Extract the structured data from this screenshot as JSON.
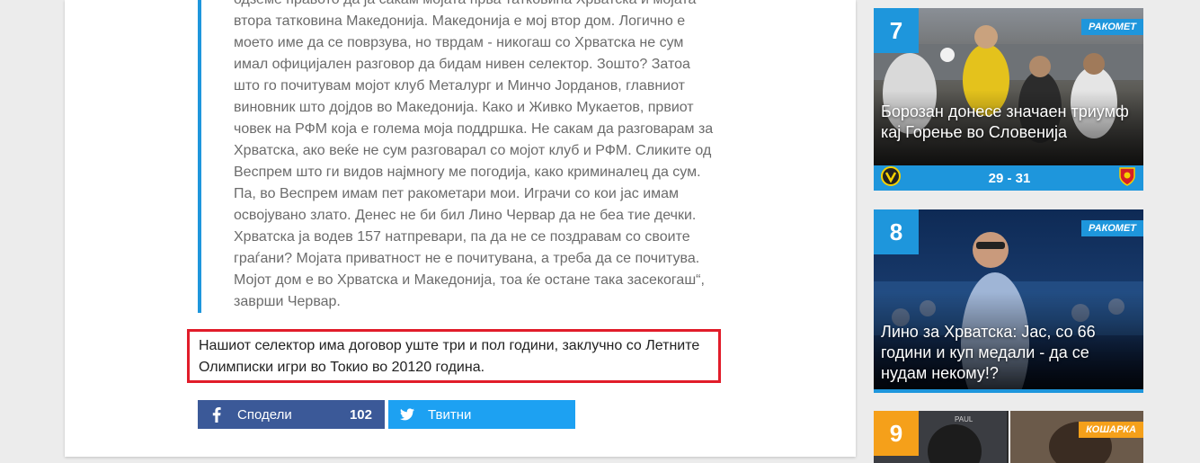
{
  "article": {
    "quote_lines": [
      "одземе правото да ја сакам мојата прва татковина Хрватска и мојата",
      "втора татковина Македонија. Македонија е мој втор дом. Логично е",
      "моето име да се поврзува, но тврдам - никогаш со Хрватска не сум",
      "имал официјален разговор да бидам нивен селектор. Зошто? Затоа",
      "што го почитувам мојот клуб Металург и Минчо Јорданов, главниот",
      "виновник што дојдов во Македонија. Како и Живко Мукаетов, првиот",
      "човек на РФМ која е голема моја поддршка. Не сакам да разговарам за",
      "Хрватска, ако веќе не сум разговарал со мојот клуб и РФМ. Сликите од",
      "Веспрем што ги видов најмногу ме погодија, како криминалец да сум.",
      "Па, во Веспрем имам пет ракометари мои. Играчи со кои јас имам",
      "освојувано злато. Денес не би бил Лино Червар да не беа тие дечки.",
      "Хрватска ја водев 157 натпревари, па да не се поздравам со своите",
      "граѓани? Мојата приватност не е почитувана, а треба да се почитува.",
      "Мојот дом е во Хрватска и Македонија, тоа ќе остане така засекогаш“,",
      "заврши Червар."
    ],
    "highlight_lines": [
      "Нашиот селектор има договор уште три и пол години, заклучно со Летните",
      "Олимписки игри во Токио во 20120 година."
    ]
  },
  "share": {
    "facebook_label": "Сподели",
    "facebook_count": "102",
    "twitter_label": "Твитни",
    "facebook_icon": "f",
    "twitter_icon": "bird"
  },
  "sidebar": {
    "cards": [
      {
        "number": "7",
        "category": "РАКОМЕТ",
        "title": "Борозан донесе значаен триумф кај Горење во Словенија",
        "score": "29 - 31"
      },
      {
        "number": "8",
        "category": "РАКОМЕТ",
        "title": "Лино за Хрватска: Јас, со 66 години и куп медали - да се нудам некому!?"
      },
      {
        "number": "9",
        "category": "КОШАРКА"
      }
    ]
  },
  "colors": {
    "accent_blue": "#1e96dc",
    "highlight_red": "#e11c2a",
    "facebook": "#3b5998",
    "twitter": "#1da1f2",
    "orange": "#f5a01a"
  }
}
